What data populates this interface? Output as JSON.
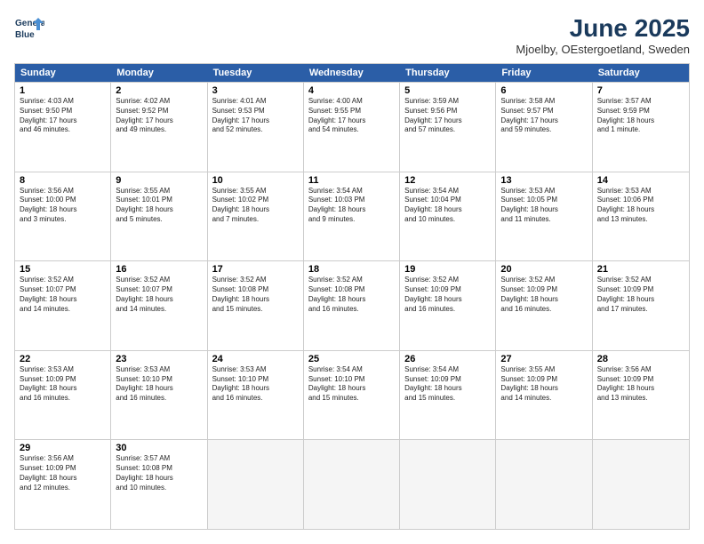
{
  "logo": {
    "line1": "General",
    "line2": "Blue"
  },
  "title": "June 2025",
  "subtitle": "Mjoelby, OEstergoetland, Sweden",
  "days_header": [
    "Sunday",
    "Monday",
    "Tuesday",
    "Wednesday",
    "Thursday",
    "Friday",
    "Saturday"
  ],
  "weeks": [
    [
      {
        "day": "1",
        "info": "Sunrise: 4:03 AM\nSunset: 9:50 PM\nDaylight: 17 hours\nand 46 minutes."
      },
      {
        "day": "2",
        "info": "Sunrise: 4:02 AM\nSunset: 9:52 PM\nDaylight: 17 hours\nand 49 minutes."
      },
      {
        "day": "3",
        "info": "Sunrise: 4:01 AM\nSunset: 9:53 PM\nDaylight: 17 hours\nand 52 minutes."
      },
      {
        "day": "4",
        "info": "Sunrise: 4:00 AM\nSunset: 9:55 PM\nDaylight: 17 hours\nand 54 minutes."
      },
      {
        "day": "5",
        "info": "Sunrise: 3:59 AM\nSunset: 9:56 PM\nDaylight: 17 hours\nand 57 minutes."
      },
      {
        "day": "6",
        "info": "Sunrise: 3:58 AM\nSunset: 9:57 PM\nDaylight: 17 hours\nand 59 minutes."
      },
      {
        "day": "7",
        "info": "Sunrise: 3:57 AM\nSunset: 9:59 PM\nDaylight: 18 hours\nand 1 minute."
      }
    ],
    [
      {
        "day": "8",
        "info": "Sunrise: 3:56 AM\nSunset: 10:00 PM\nDaylight: 18 hours\nand 3 minutes."
      },
      {
        "day": "9",
        "info": "Sunrise: 3:55 AM\nSunset: 10:01 PM\nDaylight: 18 hours\nand 5 minutes."
      },
      {
        "day": "10",
        "info": "Sunrise: 3:55 AM\nSunset: 10:02 PM\nDaylight: 18 hours\nand 7 minutes."
      },
      {
        "day": "11",
        "info": "Sunrise: 3:54 AM\nSunset: 10:03 PM\nDaylight: 18 hours\nand 9 minutes."
      },
      {
        "day": "12",
        "info": "Sunrise: 3:54 AM\nSunset: 10:04 PM\nDaylight: 18 hours\nand 10 minutes."
      },
      {
        "day": "13",
        "info": "Sunrise: 3:53 AM\nSunset: 10:05 PM\nDaylight: 18 hours\nand 11 minutes."
      },
      {
        "day": "14",
        "info": "Sunrise: 3:53 AM\nSunset: 10:06 PM\nDaylight: 18 hours\nand 13 minutes."
      }
    ],
    [
      {
        "day": "15",
        "info": "Sunrise: 3:52 AM\nSunset: 10:07 PM\nDaylight: 18 hours\nand 14 minutes."
      },
      {
        "day": "16",
        "info": "Sunrise: 3:52 AM\nSunset: 10:07 PM\nDaylight: 18 hours\nand 14 minutes."
      },
      {
        "day": "17",
        "info": "Sunrise: 3:52 AM\nSunset: 10:08 PM\nDaylight: 18 hours\nand 15 minutes."
      },
      {
        "day": "18",
        "info": "Sunrise: 3:52 AM\nSunset: 10:08 PM\nDaylight: 18 hours\nand 16 minutes."
      },
      {
        "day": "19",
        "info": "Sunrise: 3:52 AM\nSunset: 10:09 PM\nDaylight: 18 hours\nand 16 minutes."
      },
      {
        "day": "20",
        "info": "Sunrise: 3:52 AM\nSunset: 10:09 PM\nDaylight: 18 hours\nand 16 minutes."
      },
      {
        "day": "21",
        "info": "Sunrise: 3:52 AM\nSunset: 10:09 PM\nDaylight: 18 hours\nand 17 minutes."
      }
    ],
    [
      {
        "day": "22",
        "info": "Sunrise: 3:53 AM\nSunset: 10:09 PM\nDaylight: 18 hours\nand 16 minutes."
      },
      {
        "day": "23",
        "info": "Sunrise: 3:53 AM\nSunset: 10:10 PM\nDaylight: 18 hours\nand 16 minutes."
      },
      {
        "day": "24",
        "info": "Sunrise: 3:53 AM\nSunset: 10:10 PM\nDaylight: 18 hours\nand 16 minutes."
      },
      {
        "day": "25",
        "info": "Sunrise: 3:54 AM\nSunset: 10:10 PM\nDaylight: 18 hours\nand 15 minutes."
      },
      {
        "day": "26",
        "info": "Sunrise: 3:54 AM\nSunset: 10:09 PM\nDaylight: 18 hours\nand 15 minutes."
      },
      {
        "day": "27",
        "info": "Sunrise: 3:55 AM\nSunset: 10:09 PM\nDaylight: 18 hours\nand 14 minutes."
      },
      {
        "day": "28",
        "info": "Sunrise: 3:56 AM\nSunset: 10:09 PM\nDaylight: 18 hours\nand 13 minutes."
      }
    ],
    [
      {
        "day": "29",
        "info": "Sunrise: 3:56 AM\nSunset: 10:09 PM\nDaylight: 18 hours\nand 12 minutes."
      },
      {
        "day": "30",
        "info": "Sunrise: 3:57 AM\nSunset: 10:08 PM\nDaylight: 18 hours\nand 10 minutes."
      },
      {
        "day": "",
        "info": ""
      },
      {
        "day": "",
        "info": ""
      },
      {
        "day": "",
        "info": ""
      },
      {
        "day": "",
        "info": ""
      },
      {
        "day": "",
        "info": ""
      }
    ]
  ]
}
